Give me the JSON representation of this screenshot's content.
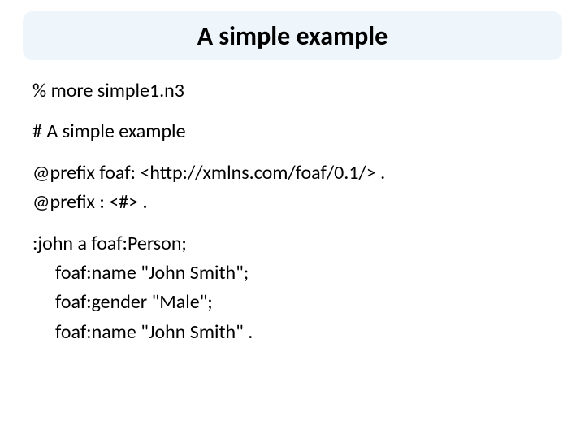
{
  "title": "A simple example",
  "lines": {
    "l1": "% more simple1.n3",
    "l2": "# A simple example",
    "l3": "@prefix foaf: <http://xmlns.com/foaf/0.1/> .",
    "l4": "@prefix : <#> .",
    "l5": ":john a foaf:Person;",
    "l6": "foaf:name \"John Smith\";",
    "l7": "foaf:gender \"Male\";",
    "l8": "foaf:name \"John Smith\" ."
  }
}
